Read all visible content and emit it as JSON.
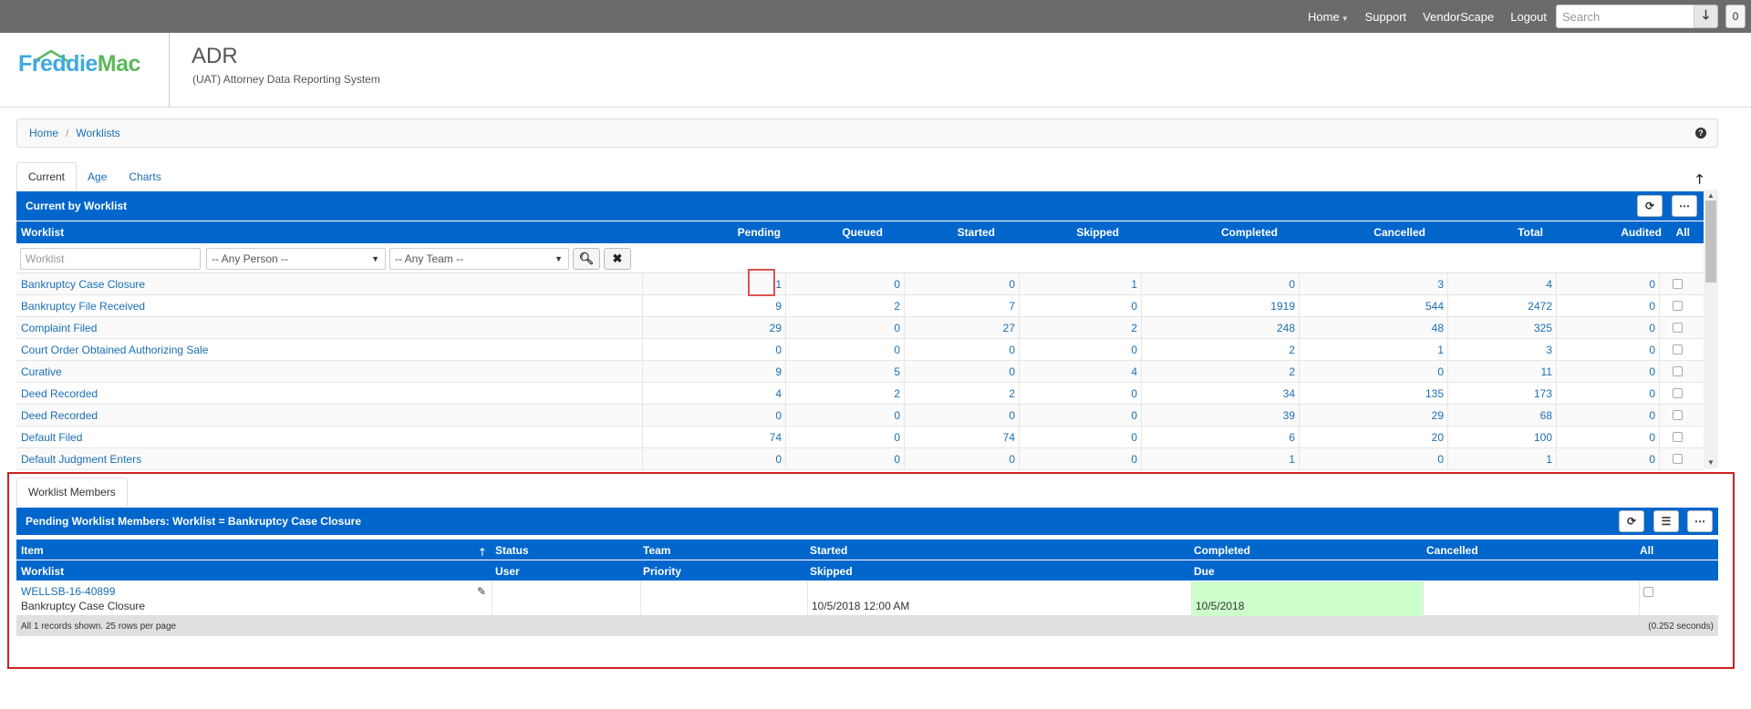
{
  "topnav": {
    "home": "Home",
    "support": "Support",
    "vendorscape": "VendorScape",
    "logout": "Logout",
    "search_placeholder": "Search",
    "count": "0"
  },
  "header": {
    "logo_freddie": "Freddie",
    "logo_mac": "Mac",
    "title": "ADR",
    "subtitle": "(UAT) Attorney Data Reporting System"
  },
  "breadcrumb": [
    "Home",
    "Worklists"
  ],
  "tabs": [
    "Current",
    "Age",
    "Charts"
  ],
  "worklist_panel": {
    "title": "Current by Worklist",
    "columns": [
      "Worklist",
      "Pending",
      "Queued",
      "Started",
      "Skipped",
      "Completed",
      "Cancelled",
      "Total",
      "Audited",
      "All"
    ],
    "filters": {
      "worklist_placeholder": "Worklist",
      "person": "-- Any Person --",
      "team": "-- Any Team --"
    },
    "rows": [
      {
        "name": "Bankruptcy Case Closure",
        "pending": "1",
        "queued": "0",
        "started": "0",
        "skipped": "1",
        "completed": "0",
        "cancelled": "3",
        "total": "4",
        "audited": "0"
      },
      {
        "name": "Bankruptcy File Received",
        "pending": "9",
        "queued": "2",
        "started": "7",
        "skipped": "0",
        "completed": "1919",
        "cancelled": "544",
        "total": "2472",
        "audited": "0"
      },
      {
        "name": "Complaint Filed",
        "pending": "29",
        "queued": "0",
        "started": "27",
        "skipped": "2",
        "completed": "248",
        "cancelled": "48",
        "total": "325",
        "audited": "0"
      },
      {
        "name": "Court Order Obtained Authorizing Sale",
        "pending": "0",
        "queued": "0",
        "started": "0",
        "skipped": "0",
        "completed": "2",
        "cancelled": "1",
        "total": "3",
        "audited": "0"
      },
      {
        "name": "Curative",
        "pending": "9",
        "queued": "5",
        "started": "0",
        "skipped": "4",
        "completed": "2",
        "cancelled": "0",
        "total": "11",
        "audited": "0"
      },
      {
        "name": "Deed Recorded",
        "pending": "4",
        "queued": "2",
        "started": "2",
        "skipped": "0",
        "completed": "34",
        "cancelled": "135",
        "total": "173",
        "audited": "0"
      },
      {
        "name": "Deed Recorded",
        "pending": "0",
        "queued": "0",
        "started": "0",
        "skipped": "0",
        "completed": "39",
        "cancelled": "29",
        "total": "68",
        "audited": "0"
      },
      {
        "name": "Default Filed",
        "pending": "74",
        "queued": "0",
        "started": "74",
        "skipped": "0",
        "completed": "6",
        "cancelled": "20",
        "total": "100",
        "audited": "0"
      },
      {
        "name": "Default Judgment Enters",
        "pending": "0",
        "queued": "0",
        "started": "0",
        "skipped": "0",
        "completed": "1",
        "cancelled": "0",
        "total": "1",
        "audited": "0"
      }
    ]
  },
  "members_panel": {
    "tab": "Worklist Members",
    "title": "Pending Worklist Members: Worklist = Bankruptcy Case Closure",
    "header1": [
      "Item",
      "Status",
      "Team",
      "Started",
      "Completed",
      "Cancelled",
      "All"
    ],
    "header2": [
      "Worklist",
      "User",
      "Priority",
      "Skipped",
      "Due"
    ],
    "row": {
      "item": "WELLSB-16-40899",
      "worklist": "Bankruptcy Case Closure",
      "skipped": "10/5/2018 12:00 AM",
      "due": "10/5/2018"
    },
    "footer_left": "All 1 records shown. 25 rows per page",
    "footer_right": "(0.252 seconds)"
  },
  "colors": {
    "navbar": "#6b6b6b",
    "panel_header": "#0066cc",
    "link": "#1a6fb5",
    "due_highlight": "#ccffcc",
    "annotation_red": "#cc2222"
  }
}
